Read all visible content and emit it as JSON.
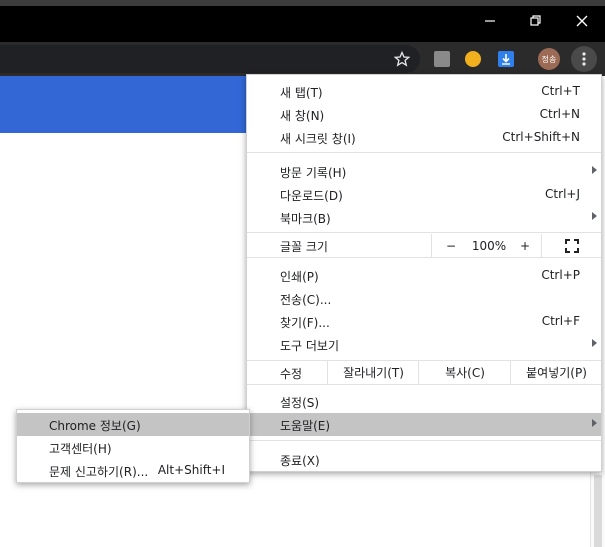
{
  "toolbar": {
    "avatar_text": "정송",
    "star_icon": "star-outline-icon",
    "menu_icon": "vertical-dots-icon"
  },
  "menu": {
    "new_tab": {
      "label": "새 탭(T)",
      "shortcut": "Ctrl+T"
    },
    "new_window": {
      "label": "새 창(N)",
      "shortcut": "Ctrl+N"
    },
    "new_incognito": {
      "label": "새 시크릿 창(I)",
      "shortcut": "Ctrl+Shift+N"
    },
    "history": {
      "label": "방문 기록(H)"
    },
    "downloads": {
      "label": "다운로드(D)",
      "shortcut": "Ctrl+J"
    },
    "bookmarks": {
      "label": "북마크(B)"
    },
    "zoom": {
      "label": "글꼴 크기",
      "minus": "−",
      "value": "100%",
      "plus": "+"
    },
    "print": {
      "label": "인쇄(P)",
      "shortcut": "Ctrl+P"
    },
    "cast": {
      "label": "전송(C)..."
    },
    "find": {
      "label": "찾기(F)...",
      "shortcut": "Ctrl+F"
    },
    "more_tools": {
      "label": "도구 더보기"
    },
    "edit": {
      "label": "수정",
      "cut": "잘라내기(T)",
      "copy": "복사(C)",
      "paste": "붙여넣기(P)"
    },
    "settings": {
      "label": "설정(S)"
    },
    "help": {
      "label": "도움말(E)"
    },
    "exit": {
      "label": "종료(X)"
    }
  },
  "submenu": {
    "about": {
      "label": "Chrome 정보(G)"
    },
    "help_center": {
      "label": "고객센터(H)"
    },
    "report_issue": {
      "label": "문제 신고하기(R)...",
      "shortcut": "Alt+Shift+I"
    }
  },
  "colors": {
    "accent": "#3367d6",
    "highlight": "#c4c4c4",
    "menu_bg": "#ffffff"
  }
}
